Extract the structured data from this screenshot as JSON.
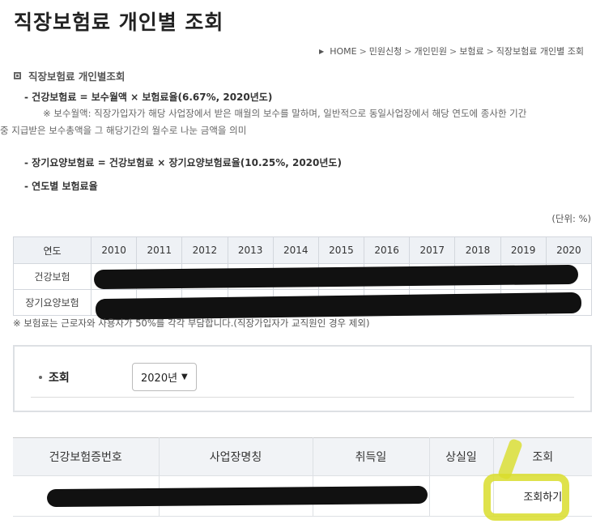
{
  "page": {
    "title": "직장보험료 개인별 조회"
  },
  "breadcrumb": {
    "items": [
      "HOME",
      "민원신청",
      "개인민원",
      "보험료",
      "직장보험료 개인별 조회"
    ],
    "separator": ">"
  },
  "section": {
    "title": "직장보험료 개인별조회"
  },
  "info": {
    "formula_health": "- 건강보험료 = 보수월액 × 보험료율(6.67%, 2020년도)",
    "note_line1": "※ 보수월액: 직장가입자가 해당 사업장에서 받은 매월의 보수를 말하며, 일반적으로 동일사업장에서 해당 연도에 종사한 기간",
    "note_line2": "중 지급받은 보수총액을 그 해당기간의 월수로 나눈 금액을 의미",
    "formula_ltc": "- 장기요양보험료 = 건강보험료 × 장기요양보험료율(10.25%, 2020년도)",
    "rate_by_year": "- 연도별 보험료율"
  },
  "unit_label": "(단위: %)",
  "rate_table": {
    "header_label": "연도",
    "years": [
      "2010",
      "2011",
      "2012",
      "2013",
      "2014",
      "2015",
      "2016",
      "2017",
      "2018",
      "2019",
      "2020"
    ],
    "rows": [
      {
        "label": "건강보험"
      },
      {
        "label": "장기요양보험"
      }
    ]
  },
  "footnote": "※ 보험료는 근로자와 사용자가 50%를 각각 부담합니다.(직장가입자가 교직원인 경우 제외)",
  "search": {
    "label": "조회",
    "selected_year": "2020년"
  },
  "result_table": {
    "headers": [
      "건강보험증번호",
      "사업장명칭",
      "취득일",
      "상실일",
      "조회"
    ],
    "row": {
      "lookup_button": "조회하기"
    }
  },
  "colors": {
    "highlight": "#d9dd2b",
    "redaction": "#111111",
    "table_header_bg": "#eef1f5"
  }
}
